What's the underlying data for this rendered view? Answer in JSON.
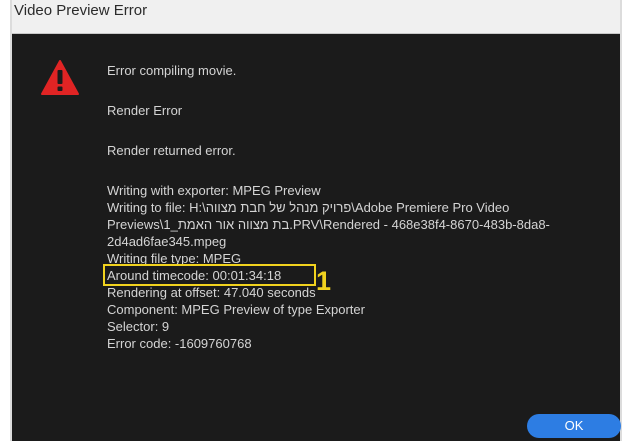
{
  "dialog": {
    "title": "Video Preview Error",
    "icon": "warning-triangle-icon",
    "messages": [
      "Error compiling movie.",
      "Render Error",
      "Render returned error."
    ],
    "details": [
      "Writing with exporter: MPEG Preview",
      "Writing to file: H:\\פרויק מנהל של חבת מצווה\\Adobe Premiere Pro Video",
      "Previews\\1_בת מצווה אור האמת.PRV\\Rendered - 468e38f4-8670-483b-8da8-",
      "2d4ad6fae345.mpeg",
      "Writing file type: MPEG",
      "Around timecode: 00:01:34:18",
      "Rendering at offset: 47.040 seconds",
      "Component: MPEG Preview of type Exporter",
      "Selector: 9",
      "Error code: -1609760768"
    ],
    "ok_label": "OK"
  },
  "annotation": {
    "marker_label": "1",
    "highlight_color": "#f1d21e"
  },
  "colors": {
    "dialog_bg": "#1b1b1b",
    "text": "#d4d4d4",
    "warning_red": "#e02424",
    "button_blue": "#2d7de3"
  }
}
